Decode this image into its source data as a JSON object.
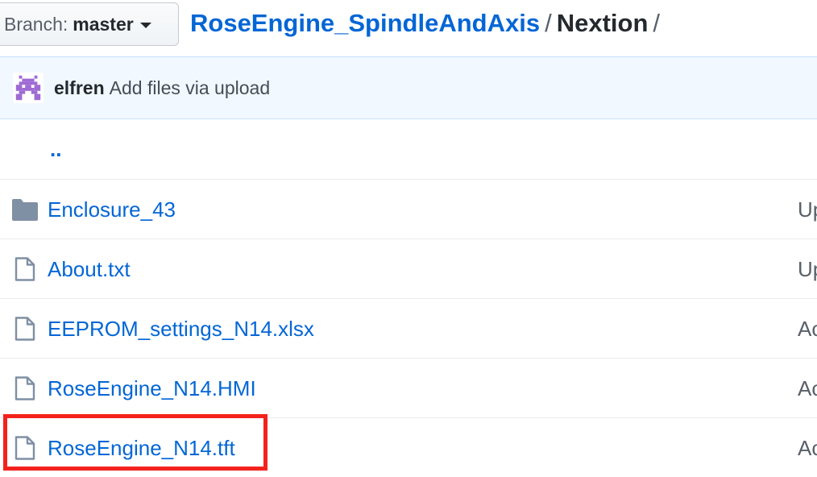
{
  "branch": {
    "prefix": "Branch:",
    "name": "master"
  },
  "breadcrumb": {
    "repo": "RoseEngine_SpindleAndAxis",
    "separator": "/",
    "current": "Nextion"
  },
  "commit": {
    "author": "elfren",
    "message": "Add files via upload",
    "avatar_color": "#9e6ad4"
  },
  "files": {
    "up": "..",
    "items": [
      {
        "name": "Enclosure_43",
        "type": "folder",
        "message": "Up"
      },
      {
        "name": "About.txt",
        "type": "file",
        "message": "Up"
      },
      {
        "name": "EEPROM_settings_N14.xlsx",
        "type": "file",
        "message": "Ac"
      },
      {
        "name": "RoseEngine_N14.HMI",
        "type": "file",
        "message": "Ac"
      },
      {
        "name": "RoseEngine_N14.tft",
        "type": "file",
        "message": "Ac"
      }
    ]
  },
  "colors": {
    "link": "#0366d6",
    "highlight": "#f4221c",
    "icon": "#7f8fa4"
  },
  "highlighted_item": "RoseEngine_N14.tft"
}
